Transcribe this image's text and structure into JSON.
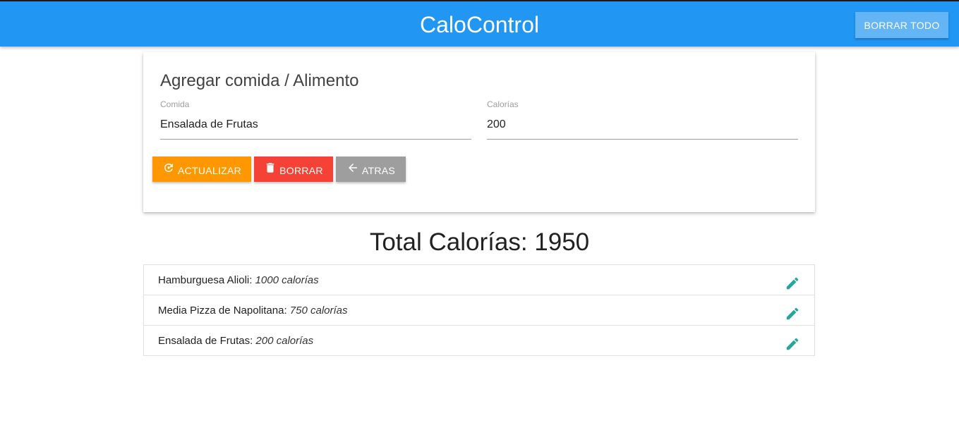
{
  "app": {
    "title": "CaloControl",
    "clear_all_label": "BORRAR TODO"
  },
  "form": {
    "title": "Agregar comida / Alimento",
    "food_label": "Comida",
    "food_value": "Ensalada de Frutas",
    "calories_label": "Calorías",
    "calories_value": "200",
    "buttons": {
      "update_label": "ACTUALIZAR",
      "delete_label": "BORRAR",
      "back_label": "ATRAS"
    }
  },
  "total": {
    "text": "Total Calorías: 1950"
  },
  "items": [
    {
      "name": "Hamburguesa Alioli:",
      "calories": "1000 calorías"
    },
    {
      "name": "Media Pizza de Napolitana:",
      "calories": "750 calorías"
    },
    {
      "name": "Ensalada de Frutas:",
      "calories": "200 calorías"
    }
  ],
  "icons": {
    "update": "refresh-icon",
    "delete": "trash-icon",
    "back": "arrow-back-icon",
    "edit": "pencil-icon"
  },
  "colors": {
    "navbar": "#2196f3",
    "clear_all": "#64b5f6",
    "update": "#ff9800",
    "delete": "#f44336",
    "back": "#9e9e9e",
    "edit_icon": "#26a69a"
  }
}
